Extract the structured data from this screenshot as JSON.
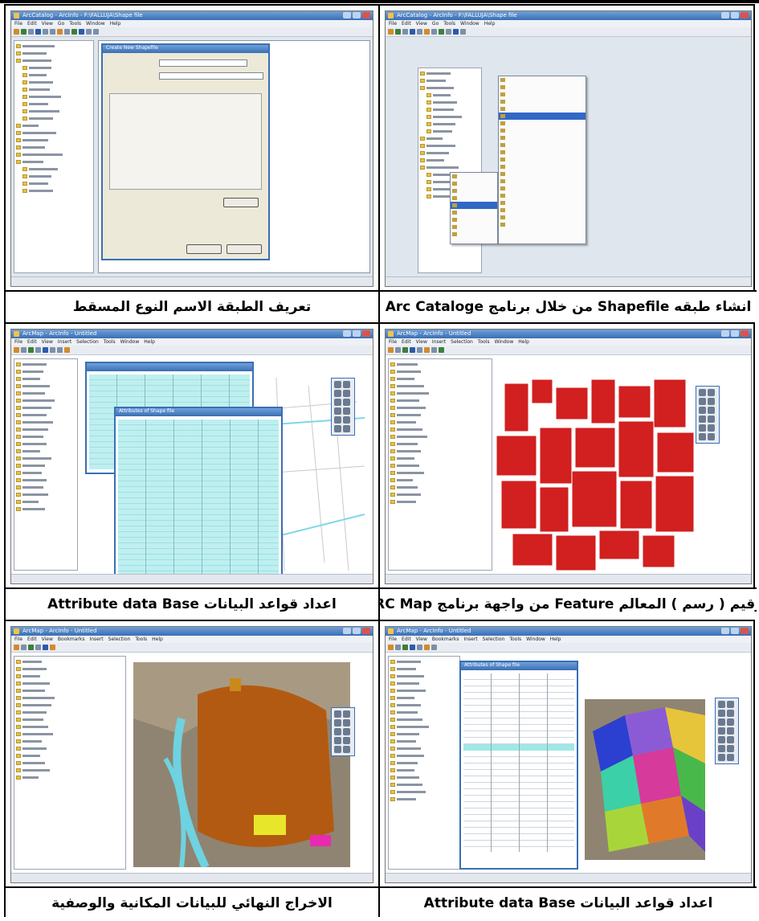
{
  "captions": {
    "top_right": "انشاء طبقه Shapefile من خلال برنامج Arc Cataloge",
    "top_left": "تعريف الطبقة الاسم النوع المسقط",
    "mid_right": "الترقيم ( رسم ) المعالم Feature من واجهة برنامج ARC Map)",
    "mid_left": "اعداد قواعد البيانات Attribute data Base",
    "bottom_right": "اعداد قواعد البيانات Attribute data Base",
    "bottom_left": "الاخراج النهائي للبيانات المكانية والوصفية"
  },
  "windows": {
    "catalog_title": "ArcCatalog - ArcInfo - F:\\FALLUJA\\Shape file",
    "arcmap_title": "ArcMap - ArcInfo - Untitled",
    "dialog_title": "Create New Shapefile",
    "table_title": "Attributes of Shape file"
  },
  "colors": {
    "feature_fill": "#d21f1f",
    "table_fill": "#bfeff0",
    "window_accent": "#3a6fb3"
  }
}
